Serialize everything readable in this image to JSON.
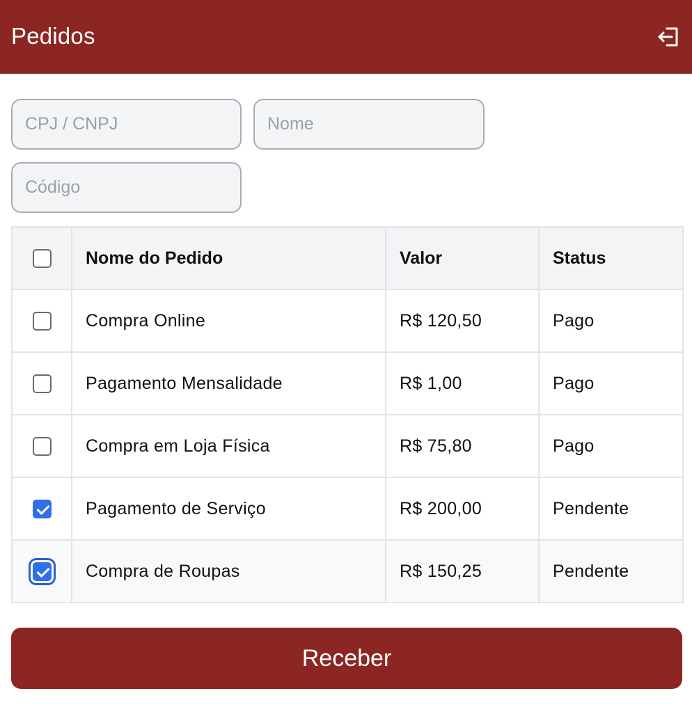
{
  "header": {
    "title": "Pedidos",
    "logout_icon": "logout-icon",
    "bg_color": "#8b2622"
  },
  "filters": {
    "cpf_placeholder": "CPJ / CNPJ",
    "nome_placeholder": "Nome",
    "codigo_placeholder": "Código"
  },
  "table": {
    "columns": [
      "Nome do Pedido",
      "Valor",
      "Status"
    ],
    "select_all_checked": false,
    "rows": [
      {
        "name": "Compra Online",
        "value": "R$ 120,50",
        "status": "Pago",
        "checked": false
      },
      {
        "name": "Pagamento Mensalidade",
        "value": "R$ 1,00",
        "status": "Pago",
        "checked": false
      },
      {
        "name": "Compra em Loja Física",
        "value": "R$ 75,80",
        "status": "Pago",
        "checked": false
      },
      {
        "name": "Pagamento de Serviço",
        "value": "R$ 200,00",
        "status": "Pendente",
        "checked": true
      },
      {
        "name": "Compra de Roupas",
        "value": "R$ 150,25",
        "status": "Pendente",
        "checked": true
      }
    ]
  },
  "actions": {
    "submit_label": "Receber",
    "accent_color": "#2f6fec"
  }
}
